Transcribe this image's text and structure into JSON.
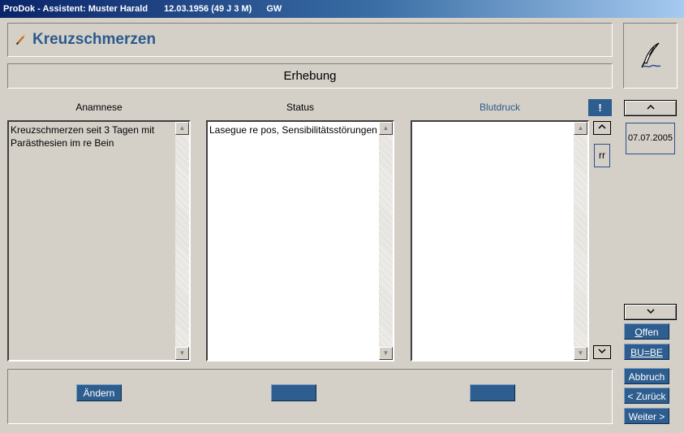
{
  "window": {
    "app": "ProDok - Assistent: Muster Harald",
    "birth": "12.03.1956 (49 J 3 M)",
    "code": "GW"
  },
  "header": {
    "title": "Kreuzschmerzen",
    "icon": "pencil-icon"
  },
  "section": {
    "title": "Erhebung"
  },
  "signature": {
    "icon": "quill-pen-icon"
  },
  "columns": {
    "anamnese": {
      "label": "Anamnese",
      "text": "Kreuzschmerzen seit 3 Tagen mit Parästhesien im re Bein"
    },
    "status": {
      "label": "Status",
      "text": "Lasegue re pos, Sensibilitätsstörungen"
    },
    "blutdruck": {
      "label": "Blutdruck",
      "text": ""
    }
  },
  "alert_button": "!",
  "mini_scroll": {
    "up": "^",
    "rr": "rr",
    "down": "v"
  },
  "nav": {
    "up": "^",
    "date": "07.07.2005",
    "down": "v"
  },
  "side_buttons": {
    "offen": {
      "u": "O",
      "rest": "ffen"
    },
    "bube": {
      "u": "BU=BE",
      "rest": ""
    },
    "abbruch": "Abbruch",
    "zurueck": "< Zurück",
    "weiter": "Weiter >"
  },
  "bottom_buttons": {
    "aendern": "Ändern",
    "btn2": "",
    "btn3": ""
  },
  "colors": {
    "accent": "#2e5e8f",
    "title_text": "#2b5a8c",
    "background": "#d4d0c8"
  }
}
